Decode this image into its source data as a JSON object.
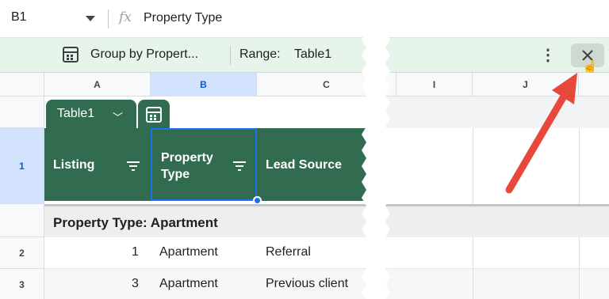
{
  "formula_bar": {
    "cell_ref": "B1",
    "fx_icon": "fx-icon",
    "value": "Property Type"
  },
  "table_toolbar": {
    "icon": "table-icon",
    "group_label": "Group by Propert...",
    "range_label": "Range:",
    "range_value": "Table1",
    "more_icon": "more-vertical-icon",
    "close_icon": "close-icon"
  },
  "columns": [
    "A",
    "B",
    "C",
    "I",
    "J"
  ],
  "rows": [
    "1",
    "2",
    "3"
  ],
  "table_chip": {
    "name": "Table1",
    "dropdown_icon": "chevron-down-icon",
    "calc_icon": "table-icon"
  },
  "headers": [
    {
      "label": "Listing"
    },
    {
      "label": "Property Type"
    },
    {
      "label": "Lead Source"
    }
  ],
  "group": {
    "label": "Property Type: Apartment"
  },
  "data_rows": [
    {
      "listing": "1",
      "property_type": "Apartment",
      "lead_source": "Referral"
    },
    {
      "listing": "3",
      "property_type": "Apartment",
      "lead_source": "Previous client"
    }
  ],
  "colors": {
    "table_header": "#316b50",
    "toolbar_bg": "#e6f4ea",
    "selection": "#1a73e8",
    "annotation_arrow": "#e8483c"
  }
}
